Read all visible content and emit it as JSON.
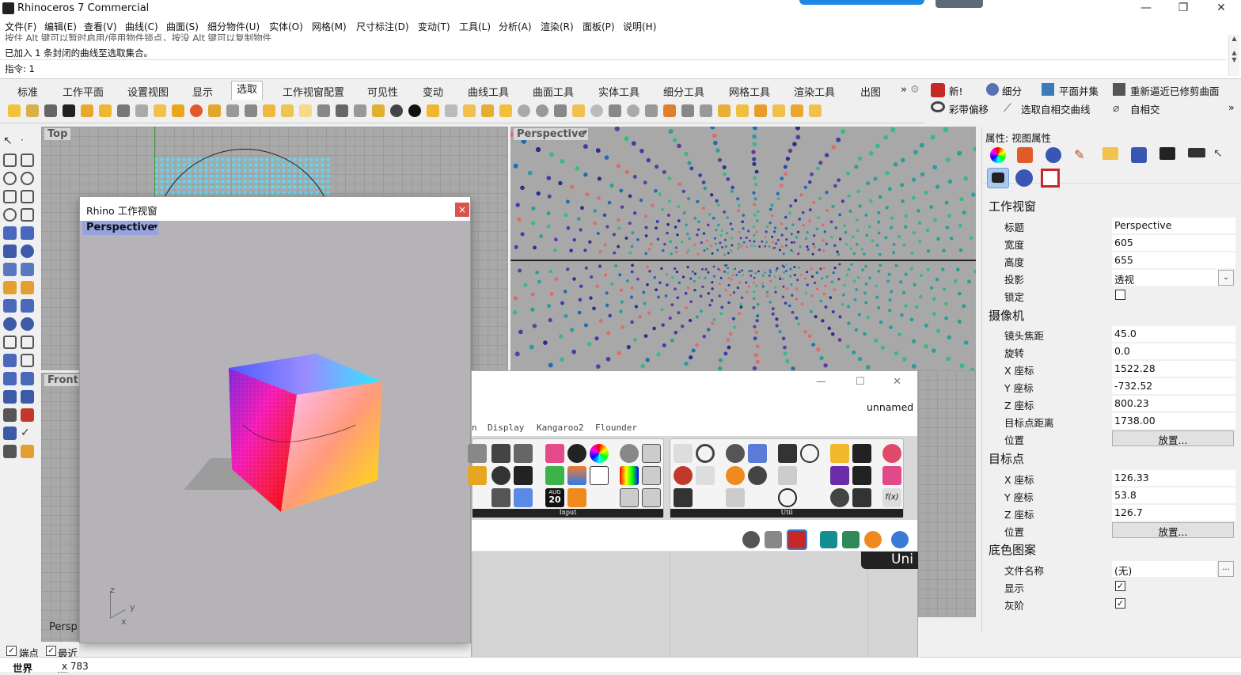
{
  "app": {
    "title": "Rhinoceros 7 Commercial"
  },
  "window_controls": {
    "minimize": "—",
    "maximize": "❐",
    "close": "✕"
  },
  "menu": [
    "文件(F)",
    "编辑(E)",
    "查看(V)",
    "曲线(C)",
    "曲面(S)",
    "细分物件(U)",
    "实体(O)",
    "网格(M)",
    "尺寸标注(D)",
    "变动(T)",
    "工具(L)",
    "分析(A)",
    "渲染(R)",
    "面板(P)",
    "说明(H)"
  ],
  "command": {
    "history1": "按住 Alt 键可以暂时启用/停用物件锁点，按没 Alt 键可以复制物件",
    "history2": "已加入 1 条封闭的曲线至选取集合。",
    "prompt": "指令: 1"
  },
  "toolbar_tabs": [
    "标准",
    "工作平面",
    "设置视图",
    "显示",
    "选取",
    "工作视窗配置",
    "可见性",
    "变动",
    "曲线工具",
    "曲面工具",
    "实体工具",
    "细分工具",
    "网格工具",
    "渲染工具",
    "出图"
  ],
  "toolbar_tabs_more": "»",
  "right_tools": {
    "new": "新!",
    "subd": "细分",
    "planar_union": "平面并集",
    "rebuild": "重新逼近已修剪曲面",
    "ribbon": "彩带偏移",
    "select_self_intersect": "选取自相交曲线",
    "self_intersect": "自相交",
    "more": "»"
  },
  "viewports": {
    "top": "Top",
    "front": "Front",
    "perspective": "Perspective",
    "persp_partial": "Persp"
  },
  "dialog": {
    "title": "Rhino 工作视窗",
    "viewport_label": "Perspective",
    "close": "×",
    "axes": {
      "z": "z",
      "y": "y",
      "x": "x"
    }
  },
  "grasshopper": {
    "doc_name": "unnamed",
    "tabs": [
      "n",
      "Display",
      "Kangaroo2",
      "Flounder"
    ],
    "group_input": "Input",
    "group_util": "Util",
    "date_badge": {
      "month": "AUG",
      "day": "20"
    },
    "overlay": "Uni",
    "win_min": "—",
    "win_max": "☐",
    "win_close": "✕"
  },
  "properties": {
    "header": "属性: 视图属性",
    "sections": {
      "viewport": "工作视窗",
      "camera": "摄像机",
      "target": "目标点",
      "wallpaper": "底色图案"
    },
    "viewport_rows": [
      {
        "label": "标题",
        "value": "Perspective"
      },
      {
        "label": "宽度",
        "value": "605"
      },
      {
        "label": "高度",
        "value": "655"
      },
      {
        "label": "投影",
        "value": "透视"
      },
      {
        "label": "锁定",
        "value": ""
      }
    ],
    "camera_rows": [
      {
        "label": "镜头焦距",
        "value": "45.0"
      },
      {
        "label": "旋转",
        "value": "0.0"
      },
      {
        "label": "X 座标",
        "value": "1522.28"
      },
      {
        "label": "Y 座标",
        "value": "-732.52"
      },
      {
        "label": "Z 座标",
        "value": "800.23"
      },
      {
        "label": "目标点距离",
        "value": "1738.00"
      },
      {
        "label": "位置",
        "value": "放置..."
      }
    ],
    "target_rows": [
      {
        "label": "X 座标",
        "value": "126.33"
      },
      {
        "label": "Y 座标",
        "value": "53.8"
      },
      {
        "label": "Z 座标",
        "value": "126.7"
      },
      {
        "label": "位置",
        "value": "放置..."
      }
    ],
    "wallpaper_rows": [
      {
        "label": "文件名称",
        "value": "(无)"
      },
      {
        "label": "显示",
        "value": "✓"
      },
      {
        "label": "灰阶",
        "value": "✓"
      }
    ],
    "browse": "..."
  },
  "status": {
    "osnap_end": "端点",
    "osnap_near": "最近点",
    "world": "世界",
    "coord": "x 783"
  }
}
